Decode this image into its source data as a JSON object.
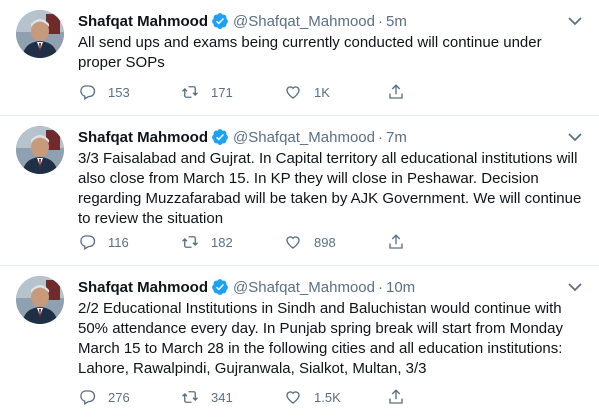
{
  "tweets": [
    {
      "name": "Shafqat Mahmood",
      "handle": "@Shafqat_Mahmood",
      "separator": "·",
      "time": "5m",
      "text": "All send ups and exams being currently conducted will continue under\nproper SOPs",
      "replies": "153",
      "retweets": "171",
      "likes": "1K"
    },
    {
      "name": "Shafqat Mahmood",
      "handle": "@Shafqat_Mahmood",
      "separator": "·",
      "time": "7m",
      "text": "3/3 Faisalabad and Gujrat.  In Capital territory all educational institutions will\nalso close from March 15. In KP they will close in Peshawar. Decision\nregarding Muzzafarabad will be taken by AJK Government. We will continue\nto review the situation",
      "replies": "116",
      "retweets": "182",
      "likes": "898"
    },
    {
      "name": "Shafqat Mahmood",
      "handle": "@Shafqat_Mahmood",
      "separator": "·",
      "time": "10m",
      "text": "2/2 Educational Institutions in Sindh and Baluchistan would continue with\n50% attendance every day. In Punjab spring break will start from Monday\nMarch 15 to March 28 in the following cities and all education institutions:\nLahore, Rawalpindi, Gujranwala, Sialkot, Multan, 3/3",
      "replies": "276",
      "retweets": "341",
      "likes": "1.5K"
    }
  ],
  "colors": {
    "verified": "#1da1f2",
    "muted": "#5b7083",
    "text": "#0f1419",
    "divider": "#e6ecf0"
  },
  "icons": [
    "verified-badge-icon",
    "chevron-down-icon",
    "reply-icon",
    "retweet-icon",
    "like-icon",
    "share-icon"
  ]
}
